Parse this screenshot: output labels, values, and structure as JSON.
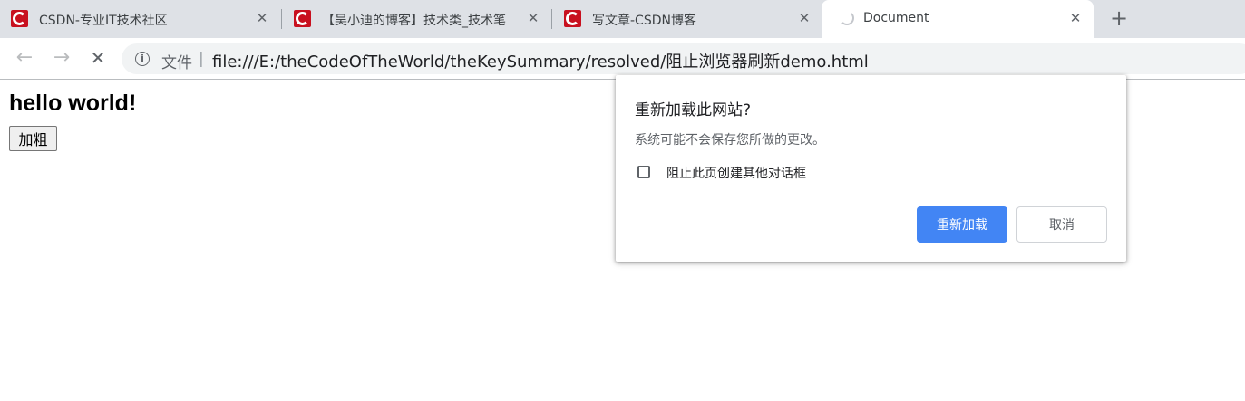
{
  "tabs": [
    {
      "title": "CSDN-专业IT技术社区",
      "favicon": "csdn-favicon",
      "active": false
    },
    {
      "title": "【吴小迪的博客】技术类_技术笔",
      "favicon": "csdn-favicon",
      "active": false
    },
    {
      "title": "写文章-CSDN博客",
      "favicon": "csdn-favicon",
      "active": false
    },
    {
      "title": "Document",
      "favicon": "loading-spinner",
      "active": true
    }
  ],
  "tab_close_glyph": "✕",
  "new_tab_glyph": "+",
  "toolbar": {
    "back_glyph": "←",
    "forward_glyph": "→",
    "stop_glyph": "✕",
    "info_glyph": "i",
    "scheme_label": "文件",
    "separator": "|",
    "url": "file:///E:/theCodeOfTheWorld/theKeySummary/resolved/阻止浏览器刷新demo.html"
  },
  "page": {
    "heading": "hello world!",
    "bold_button_label": "加粗"
  },
  "dialog": {
    "title": "重新加载此网站?",
    "message": "系统可能不会保存您所做的更改。",
    "checkbox_label": "阻止此页创建其他对话框",
    "checkbox_checked": false,
    "confirm_label": "重新加载",
    "cancel_label": "取消"
  },
  "colors": {
    "favicon_red": "#c8101f",
    "primary_button": "#4285f4",
    "tabstrip_bg": "#dee1e6"
  }
}
